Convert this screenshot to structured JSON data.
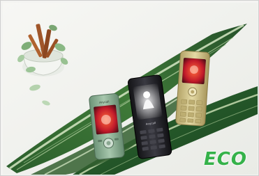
{
  "photo": {
    "eco_text": "ECO",
    "phone_left_brand": "Anycall",
    "phone_middle_brand": "Anycall",
    "colors": {
      "eco_green": "#35b24a",
      "phone_left_body": "#7fa58a",
      "phone_middle_body": "#1c1c22",
      "phone_right_body": "#c9b97a",
      "leaf_dark": "#1f4d25",
      "leaf_light": "#cfe4b8",
      "background": "#f4f4f2"
    },
    "icons": [
      "cinnamon-stick-plant-pot-icon",
      "leaf-icon",
      "mobile-phone-icon"
    ]
  }
}
